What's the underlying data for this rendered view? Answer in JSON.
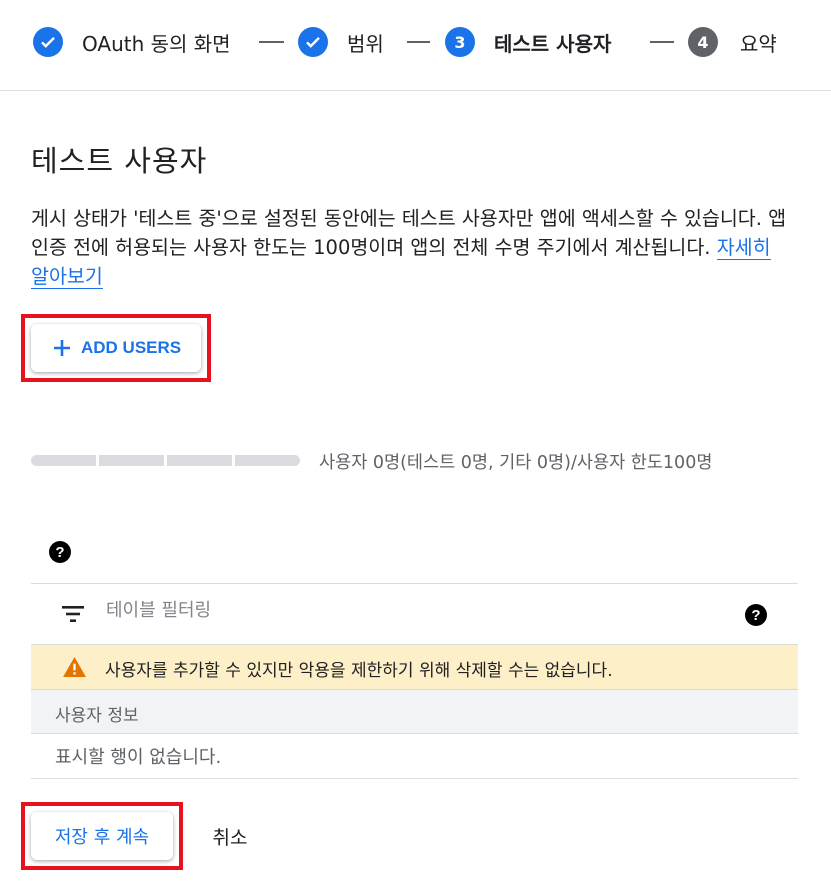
{
  "stepper": {
    "steps": [
      {
        "label": "OAuth 동의 화면",
        "state": "done",
        "number": ""
      },
      {
        "label": "범위",
        "state": "done",
        "number": ""
      },
      {
        "label": "테스트 사용자",
        "state": "active",
        "number": "3"
      },
      {
        "label": "요약",
        "state": "todo",
        "number": "4"
      }
    ]
  },
  "page": {
    "title": "테스트 사용자",
    "description": "게시 상태가 '테스트 중'으로 설정된 동안에는 테스트 사용자만 앱에 액세스할 수 있습니다. 앱 인증 전에 허용되는 사용자 한도는 100명이며 앱의 전체 수명 주기에서 계산됩니다.",
    "learn_more": "자세히 알아보기"
  },
  "add_users": {
    "label": "ADD USERS",
    "icon": "plus-icon"
  },
  "quota": {
    "text": "사용자 0명(테스트 0명, 기타 0명)/사용자 한도100명",
    "used_fraction": 0
  },
  "table": {
    "filter_placeholder": "테이블 필터링",
    "warning": "사용자를 추가할 수 있지만 악용을 제한하기 위해 삭제할 수는 없습니다.",
    "column_header": "사용자 정보",
    "empty_message": "표시할 행이 없습니다."
  },
  "actions": {
    "save_label": "저장 후 계속",
    "cancel_label": "취소"
  },
  "colors": {
    "accent": "#1a73e8",
    "highlight_box": "#e8121f",
    "warning_bg": "#fdefc7",
    "warning_icon": "#e37400"
  }
}
